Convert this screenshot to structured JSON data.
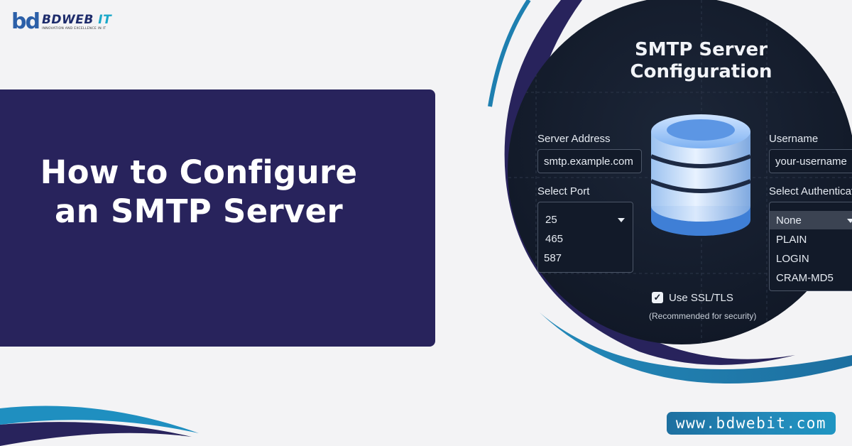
{
  "logo": {
    "mark": "bd",
    "brand_a": "BDWEB",
    "brand_b": " IT",
    "tagline": "INNOVATION AND EXCELLENCE IN IT"
  },
  "hero": {
    "title_line1": "How to Configure",
    "title_line2": "an SMTP Server"
  },
  "website": "www.bdwebit.com",
  "screen": {
    "title_line1": "SMTP Server",
    "title_line2": "Configuration",
    "server_address_label": "Server Address",
    "server_address_value": "smtp.example.com",
    "username_label": "Username",
    "username_value": "your-username",
    "port_label": "Select Port",
    "port_options": [
      "25",
      "465",
      "587"
    ],
    "auth_label": "Select Authenticat",
    "auth_options": [
      "None",
      "PLAIN",
      "LOGIN",
      "CRAM-MD5"
    ],
    "ssl_label": "Use SSL/TLS",
    "ssl_note": "(Recommended for security)",
    "ssl_checked": true
  },
  "colors": {
    "background": "#f3f3f5",
    "card": "#28235c",
    "accent_teal": "#1f95c2",
    "accent_navy": "#28235c",
    "screen_bg": "#141c2b"
  },
  "icons": [
    "database-icon",
    "checkbox-checked-icon",
    "dropdown-caret-icon"
  ]
}
